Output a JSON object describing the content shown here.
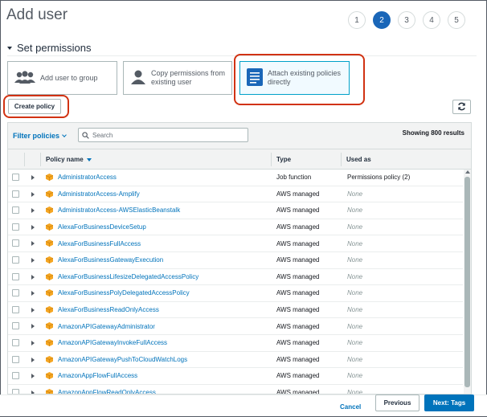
{
  "page": {
    "title": "Add user"
  },
  "steps": [
    "1",
    "2",
    "3",
    "4",
    "5"
  ],
  "active_step": 2,
  "section": {
    "title": "Set permissions"
  },
  "options": {
    "add_to_group": "Add user to group",
    "copy_permissions": "Copy permissions from existing user",
    "attach_policies": "Attach existing policies directly"
  },
  "toolbar": {
    "create_policy": "Create policy"
  },
  "table": {
    "filter_label": "Filter policies",
    "search_placeholder": "Search",
    "showing": "Showing 800 results",
    "columns": {
      "name": "Policy name",
      "type": "Type",
      "used_as": "Used as"
    },
    "rows": [
      {
        "name": "AdministratorAccess",
        "type": "Job function",
        "used_as": "Permissions policy (2)"
      },
      {
        "name": "AdministratorAccess-Amplify",
        "type": "AWS managed",
        "used_as": "None"
      },
      {
        "name": "AdministratorAccess-AWSElasticBeanstalk",
        "type": "AWS managed",
        "used_as": "None"
      },
      {
        "name": "AlexaForBusinessDeviceSetup",
        "type": "AWS managed",
        "used_as": "None"
      },
      {
        "name": "AlexaForBusinessFullAccess",
        "type": "AWS managed",
        "used_as": "None"
      },
      {
        "name": "AlexaForBusinessGatewayExecution",
        "type": "AWS managed",
        "used_as": "None"
      },
      {
        "name": "AlexaForBusinessLifesizeDelegatedAccessPolicy",
        "type": "AWS managed",
        "used_as": "None"
      },
      {
        "name": "AlexaForBusinessPolyDelegatedAccessPolicy",
        "type": "AWS managed",
        "used_as": "None"
      },
      {
        "name": "AlexaForBusinessReadOnlyAccess",
        "type": "AWS managed",
        "used_as": "None"
      },
      {
        "name": "AmazonAPIGatewayAdministrator",
        "type": "AWS managed",
        "used_as": "None"
      },
      {
        "name": "AmazonAPIGatewayInvokeFullAccess",
        "type": "AWS managed",
        "used_as": "None"
      },
      {
        "name": "AmazonAPIGatewayPushToCloudWatchLogs",
        "type": "AWS managed",
        "used_as": "None"
      },
      {
        "name": "AmazonAppFlowFullAccess",
        "type": "AWS managed",
        "used_as": "None"
      },
      {
        "name": "AmazonAppFlowReadOnlyAccess",
        "type": "AWS managed",
        "used_as": "None"
      }
    ]
  },
  "footer": {
    "cancel": "Cancel",
    "previous": "Previous",
    "next": "Next: Tags"
  },
  "colors": {
    "primary": "#0073bb",
    "step_active": "#1a66b8",
    "highlight": "#d13212",
    "policy_icon": "#f5a623"
  },
  "icons": {
    "add_to_group": "group-icon",
    "copy_permissions": "user-icon",
    "attach_policies": "document-icon",
    "refresh": "refresh-icon",
    "policy": "policy-cube-icon"
  }
}
